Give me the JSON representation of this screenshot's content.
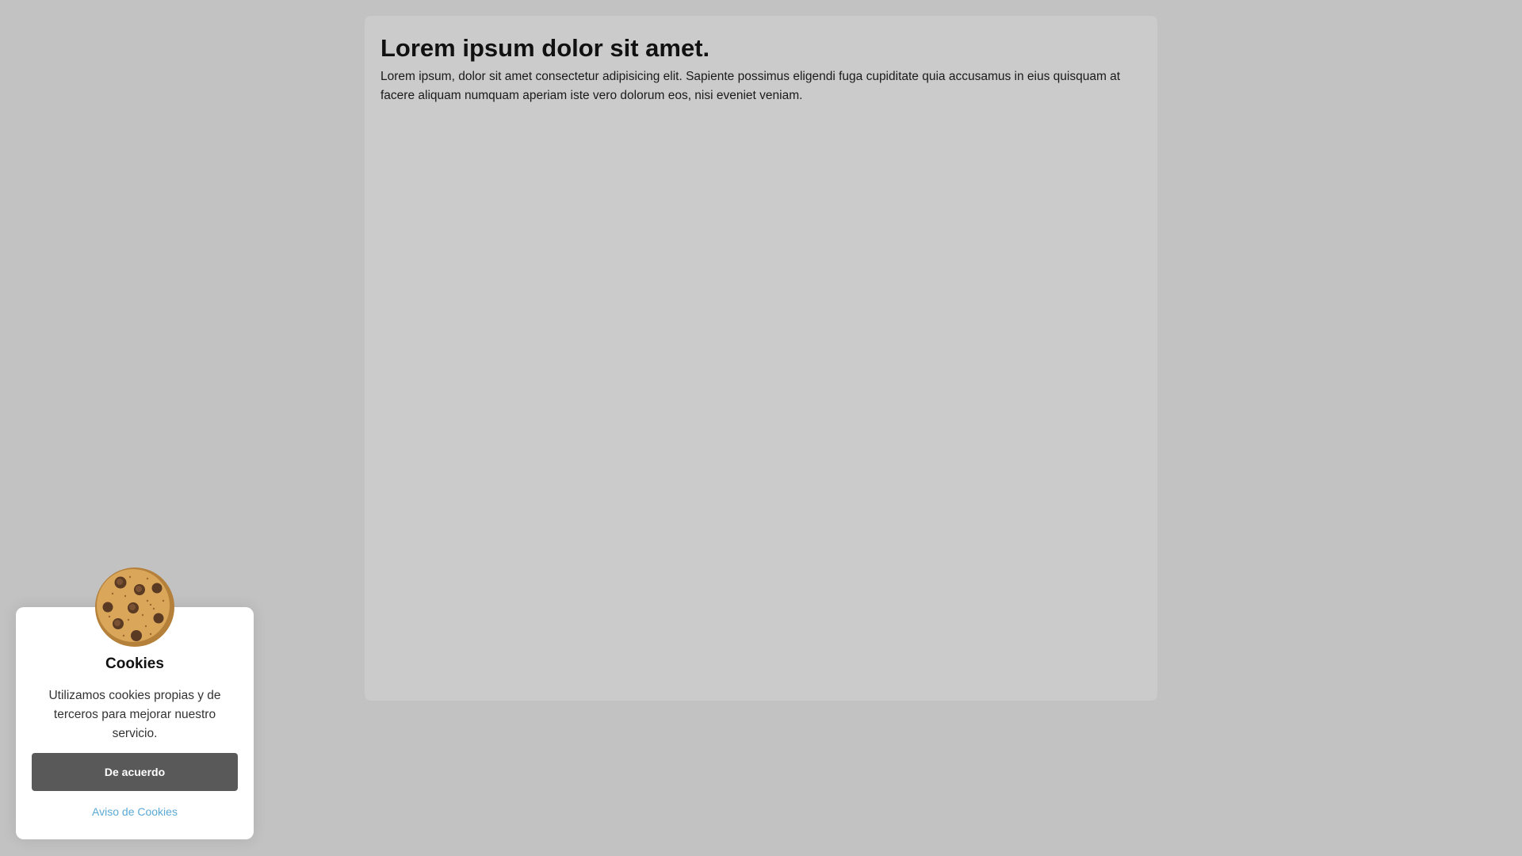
{
  "article": {
    "heading": "Lorem ipsum dolor sit amet.",
    "body": "Lorem ipsum, dolor sit amet consectetur adipisicing elit. Sapiente possimus eligendi fuga cupiditate quia accusamus in eius quisquam at facere aliquam numquam aperiam iste vero dolorum eos, nisi eveniet veniam."
  },
  "cookie_banner": {
    "icon": "cookie-icon",
    "title": "Cookies",
    "message": "Utilizamos cookies propias y de terceros para mejorar nuestro servicio.",
    "accept_label": "De acuerdo",
    "notice_link": "Aviso de Cookies",
    "colors": {
      "button": "#595959",
      "link": "#5aa9d6",
      "page_background": "#c2c2c2",
      "card_background": "#cbcbcb"
    }
  }
}
